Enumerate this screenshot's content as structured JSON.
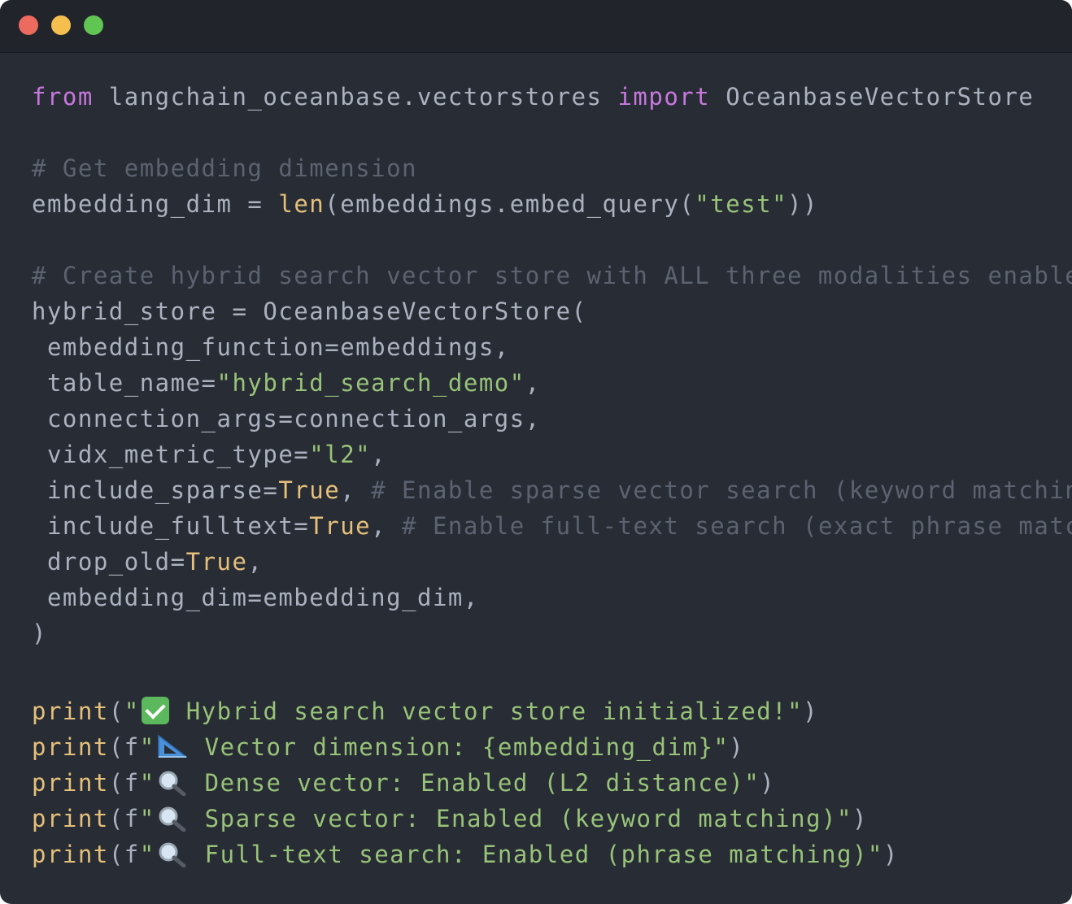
{
  "window": {
    "controls": [
      "close",
      "minimize",
      "zoom"
    ],
    "colors": {
      "close": "#ec6a5e",
      "minimize": "#f4bf4f",
      "zoom": "#61c554"
    }
  },
  "theme": {
    "background": "#282c34",
    "keyword": "#c678dd",
    "function": "#e5c07b",
    "string": "#98c379",
    "comment": "#5c6370",
    "plain": "#abb2bf"
  },
  "code": {
    "l1": {
      "from": "from",
      "module": " langchain_oceanbase.vectorstores ",
      "import": "import",
      "name": " OceanbaseVectorStore"
    },
    "l3": {
      "comment": "# Get embedding dimension"
    },
    "l4": {
      "a": "embedding_dim = ",
      "fn": "len",
      "b": "(embeddings.embed_query(",
      "str": "\"test\"",
      "c": "))"
    },
    "l6": {
      "comment": "# Create hybrid search vector store with ALL three modalities enabled"
    },
    "l7": {
      "text": "hybrid_store = OceanbaseVectorStore("
    },
    "l8": {
      "text": " embedding_function=embeddings,"
    },
    "l9": {
      "a": " table_name=",
      "str": "\"hybrid_search_demo\"",
      "b": ","
    },
    "l10": {
      "text": " connection_args=connection_args,"
    },
    "l11": {
      "a": " vidx_metric_type=",
      "str": "\"l2\"",
      "b": ","
    },
    "l12": {
      "a": " include_sparse=",
      "val": "True",
      "b": ", ",
      "comment": "# Enable sparse vector search (keyword matching)"
    },
    "l13": {
      "a": " include_fulltext=",
      "val": "True",
      "b": ", ",
      "comment": "# Enable full-text search (exact phrase matching)"
    },
    "l14": {
      "a": " drop_old=",
      "val": "True",
      "b": ","
    },
    "l15": {
      "text": " embedding_dim=embedding_dim,"
    },
    "l16": {
      "text": ")"
    },
    "l18": {
      "fn": "print",
      "a": "(",
      "str1": "\"",
      "emoji": "check-mark-emoji",
      "str2": " Hybrid search vector store initialized!\"",
      "b": ")"
    },
    "l19": {
      "fn": "print",
      "a": "(f",
      "str1": "\"",
      "emoji": "triangular-ruler-emoji",
      "str2": " Vector dimension: {embedding_dim}\"",
      "b": ")"
    },
    "l20": {
      "fn": "print",
      "a": "(f",
      "str1": "\"",
      "emoji": "magnifying-glass-emoji",
      "str2": " Dense vector: Enabled (L2 distance)\"",
      "b": ")"
    },
    "l21": {
      "fn": "print",
      "a": "(f",
      "str1": "\"",
      "emoji": "magnifying-glass-emoji",
      "str2": " Sparse vector: Enabled (keyword matching)\"",
      "b": ")"
    },
    "l22": {
      "fn": "print",
      "a": "(f",
      "str1": "\"",
      "emoji": "magnifying-glass-emoji",
      "str2": " Full-text search: Enabled (phrase matching)\"",
      "b": ")"
    }
  }
}
